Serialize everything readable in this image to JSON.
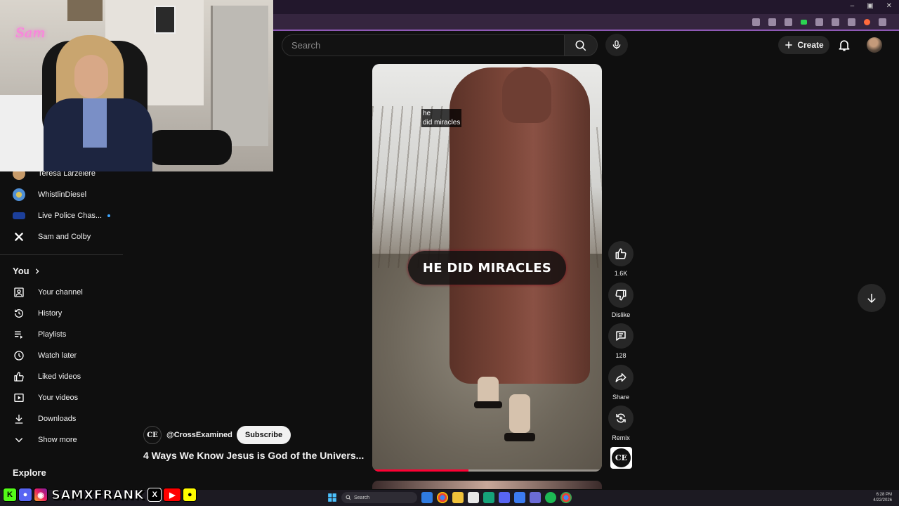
{
  "header": {
    "search_placeholder": "Search",
    "create_label": "Create"
  },
  "webcam": {
    "neon_sign": "Sam"
  },
  "sidebar": {
    "subscriptions": [
      {
        "label": "Teresa Larzelere",
        "avatar_color": "#c79b6a"
      },
      {
        "label": "WhistlinDiesel",
        "avatar_color": "#4f8fd6"
      },
      {
        "label": "Live Police Chas...",
        "avatar_color": "#1c3f9a",
        "live": true
      },
      {
        "label": "Sam and Colby",
        "avatar_color": "#ffffff"
      }
    ],
    "you_heading": "You",
    "you_items": [
      {
        "label": "Your channel",
        "icon": "account-box-icon"
      },
      {
        "label": "History",
        "icon": "history-icon"
      },
      {
        "label": "Playlists",
        "icon": "playlist-icon"
      },
      {
        "label": "Watch later",
        "icon": "clock-icon"
      },
      {
        "label": "Liked videos",
        "icon": "thumb-up-icon"
      },
      {
        "label": "Your videos",
        "icon": "play-box-icon"
      },
      {
        "label": "Downloads",
        "icon": "download-icon"
      },
      {
        "label": "Show more",
        "icon": "chevron-down-icon"
      }
    ],
    "explore_heading": "Explore"
  },
  "short": {
    "small_caption_line1": "he",
    "small_caption_line2": "did miracles",
    "big_caption": "HE DID MIRACLES",
    "progress_fraction": 0.42,
    "channel_logo": "CE",
    "channel_handle": "@CrossExamined",
    "subscribe_label": "Subscribe",
    "title": "4 Ways We Know Jesus is God of the Univers..."
  },
  "actions": {
    "likes": "1.6K",
    "dislike_label": "Dislike",
    "comments": "128",
    "share_label": "Share",
    "remix_label": "Remix"
  },
  "overlay": {
    "handle": "SAMXFRANK"
  },
  "taskbar": {
    "search_label": "Search",
    "time": "6:28 PM",
    "date": "4/22/2026"
  }
}
